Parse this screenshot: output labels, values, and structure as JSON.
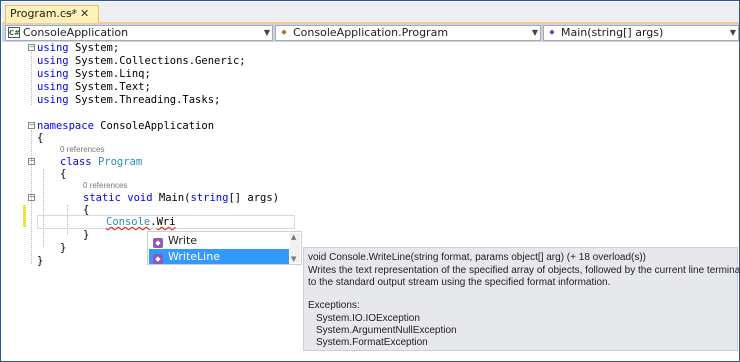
{
  "tab": {
    "title": "Program.cs*",
    "pin_icon": "pin-icon",
    "close_icon": "close-icon"
  },
  "navbar": {
    "project": "ConsoleApplication",
    "type": "ConsoleApplication.Program",
    "member": "Main(string[] args)"
  },
  "code": {
    "usings": [
      [
        "using",
        "System;"
      ],
      [
        "using",
        "System.Collections.Generic;"
      ],
      [
        "using",
        "System.Linq;"
      ],
      [
        "using",
        "System.Text;"
      ],
      [
        "using",
        "System.Threading.Tasks;"
      ]
    ],
    "namespace_kw": "namespace",
    "namespace_name": "ConsoleApplication",
    "open_brace": "{",
    "close_brace": "}",
    "refs_class": "0 references",
    "class_kw": "class",
    "class_name": "Program",
    "refs_method": "0 references",
    "method_kw_static": "static",
    "method_kw_void": "void",
    "method_name": "Main(",
    "method_param_kw": "string",
    "method_params_rest": "[] args)",
    "typed_type": "Console",
    "typed_dot": ".",
    "typed_member": "Wri"
  },
  "completion": {
    "items": [
      {
        "label": "Write",
        "icon": "method-icon",
        "selected": false
      },
      {
        "label": "WriteLine",
        "icon": "method-icon",
        "selected": true
      }
    ]
  },
  "tooltip": {
    "signature": "void Console.WriteLine(string format, params object[] arg)  (+ 18 overload(s))",
    "desc1": "Writes the text representation of the specified array of objects, followed by the current line terminator,",
    "desc2": "to the standard output stream using the specified format information.",
    "exceptions_title": "Exceptions:",
    "exceptions": [
      "System.IO.IOException",
      "System.ArgumentNullException",
      "System.FormatException"
    ]
  },
  "colors": {
    "keyword": "#0000ff",
    "type": "#2b91af",
    "selection": "#3399ff",
    "tab_active": "#fff1b8",
    "navbar": "#ccd5e8"
  }
}
